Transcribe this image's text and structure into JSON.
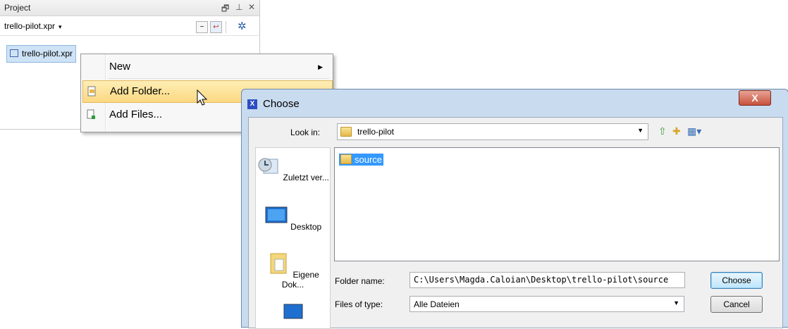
{
  "project_panel": {
    "title": "Project",
    "header_icons": [
      "restore-icon",
      "pin-icon",
      "close-icon"
    ],
    "file_label": "trello-pilot.xpr",
    "toolbar_icons": [
      "collapse-icon",
      "back-icon",
      "settings-icon"
    ],
    "tree_item": "trello-pilot.xpr"
  },
  "context_menu": {
    "items": [
      {
        "label": "New",
        "has_submenu": true
      },
      {
        "label": "Add Folder...",
        "highlighted": true,
        "icon": "add-folder-icon"
      },
      {
        "label": "Add Files...",
        "icon": "add-files-icon"
      }
    ]
  },
  "dialog": {
    "title": "Choose",
    "close_label": "X",
    "look_in_label": "Look in:",
    "look_in_value": "trello-pilot",
    "toolbar_icons": [
      "up-folder-icon",
      "new-folder-icon",
      "view-menu-icon"
    ],
    "places": [
      {
        "label": "Zuletzt ver...",
        "icon": "recent-icon"
      },
      {
        "label": "Desktop",
        "icon": "desktop-icon"
      },
      {
        "label": "Eigene Dok...",
        "icon": "documents-icon"
      },
      {
        "label": "",
        "icon": "computer-icon"
      }
    ],
    "files": [
      {
        "name": "source",
        "selected": true
      }
    ],
    "folder_name_label": "Folder name:",
    "folder_name_value": "C:\\Users\\Magda.Caloian\\Desktop\\trello-pilot\\source",
    "file_type_label": "Files of type:",
    "file_type_value": "Alle Dateien",
    "choose_label": "Choose",
    "cancel_label": "Cancel"
  },
  "colors": {
    "menu_highlight": "#fcd882",
    "selection": "#3399ff",
    "dialog_frame": "#c9dbef",
    "close_button": "#c7513d"
  }
}
